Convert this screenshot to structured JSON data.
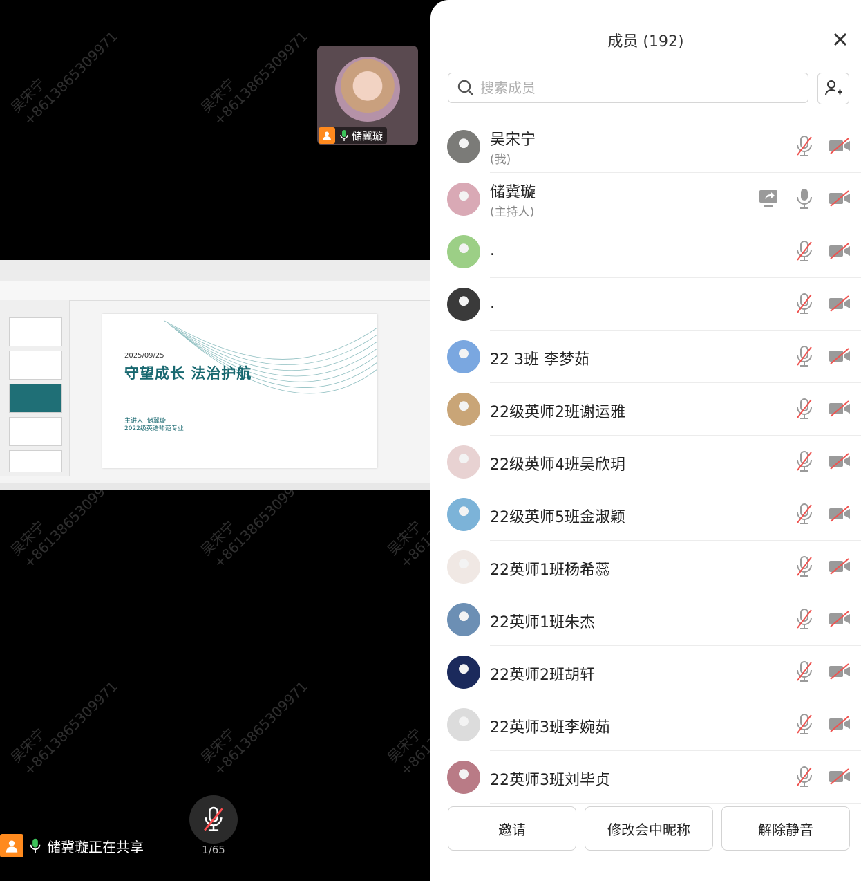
{
  "thumbnail": {
    "name": "储冀璇"
  },
  "watermark": {
    "name": "吴宋宁",
    "number": "+8613865309971"
  },
  "shared_slide": {
    "date": "2025/09/25",
    "title": "守望成长 法治护航",
    "presenter": "主讲人: 储冀璇",
    "major": "2022级英语师范专业"
  },
  "sharing_status": "储冀璇正在共享",
  "page_counter": "1/65",
  "panel": {
    "title": "成员 (192)",
    "search_placeholder": "搜索成员",
    "members": [
      {
        "name": "吴宋宁",
        "role": "(我)"
      },
      {
        "name": "储冀璇",
        "role": "(主持人)"
      },
      {
        "name": ".",
        "role": ""
      },
      {
        "name": ".",
        "role": ""
      },
      {
        "name": "22 3班 李梦茹",
        "role": ""
      },
      {
        "name": "22级英师2班谢运雅",
        "role": ""
      },
      {
        "name": "22级英师4班吴欣玥",
        "role": ""
      },
      {
        "name": "22级英师5班金淑颖",
        "role": ""
      },
      {
        "name": "22英师1班杨希蕊",
        "role": ""
      },
      {
        "name": "22英师1班朱杰",
        "role": ""
      },
      {
        "name": "22英师2班胡轩",
        "role": ""
      },
      {
        "name": "22英师3班李婉茹",
        "role": ""
      },
      {
        "name": "22英师3班刘毕贞",
        "role": ""
      }
    ],
    "buttons": {
      "invite": "邀请",
      "rename": "修改会中昵称",
      "unmute": "解除静音"
    }
  }
}
